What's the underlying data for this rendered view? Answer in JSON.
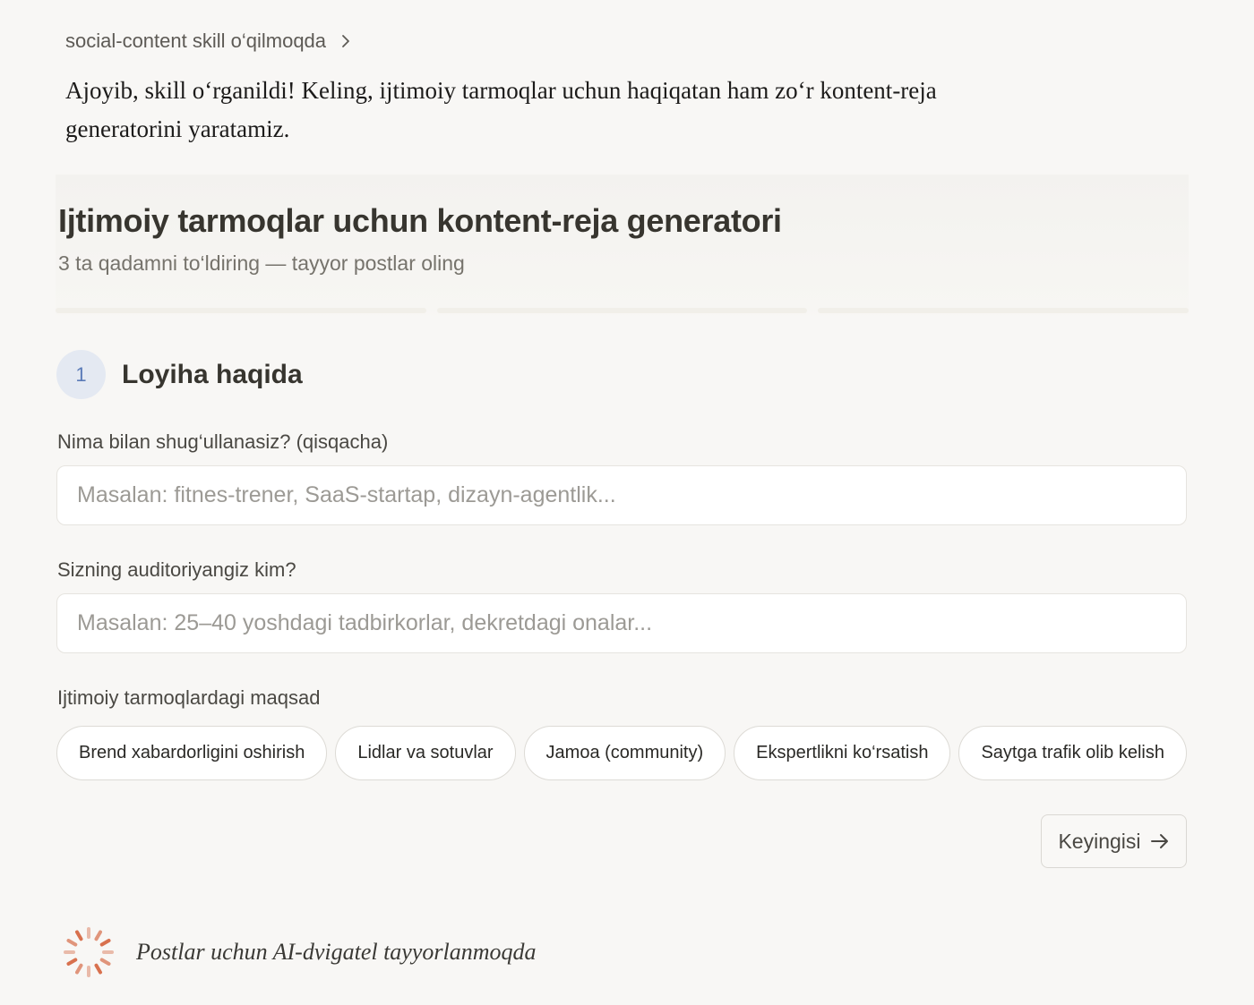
{
  "skill_status": {
    "label": "social-content skill o‘qilmoqda",
    "icon": "chevron-right-icon"
  },
  "assistant_message": "Ajoyib, skill o‘rganildi! Keling, ijtimoiy tarmoqlar uchun haqiqatan ham zo‘r kontent-reja generatorini yaratamiz.",
  "app": {
    "title": "Ijtimoiy tarmoqlar uchun kontent-reja generatori",
    "subtitle": "3 ta qadamni to‘ldiring — tayyor postlar oling",
    "progress": {
      "total_steps": 3,
      "current_step": 1
    },
    "step": {
      "number": "1",
      "title": "Loyiha haqida"
    },
    "fields": {
      "business": {
        "label": "Nima bilan shug‘ullanasiz? (qisqacha)",
        "value": "",
        "placeholder": "Masalan: fitnes-trener, SaaS-startap, dizayn-agentlik..."
      },
      "audience": {
        "label": "Sizning auditoriyangiz kim?",
        "value": "",
        "placeholder": "Masalan: 25–40 yoshdagi tadbirkorlar, dekretdagi onalar..."
      }
    },
    "goal": {
      "label": "Ijtimoiy tarmoqlardagi maqsad",
      "options": [
        "Brend xabardorligini oshirish",
        "Lidlar va sotuvlar",
        "Jamoa (community)",
        "Ekspertlikni ko‘rsatish",
        "Saytga trafik olib kelish"
      ]
    },
    "next_button": {
      "label": "Keyingisi",
      "icon": "arrow-right-icon"
    }
  },
  "loading": {
    "text": "Postlar uchun AI-dvigatel tayyorlanmoqda",
    "icon": "spinner-icon",
    "color": "#d8714e"
  },
  "colors": {
    "background": "#f8f7f5",
    "step_badge_bg": "#e4e9f2",
    "step_badge_text": "#5b7bb8",
    "spinner": "#d8714e"
  }
}
